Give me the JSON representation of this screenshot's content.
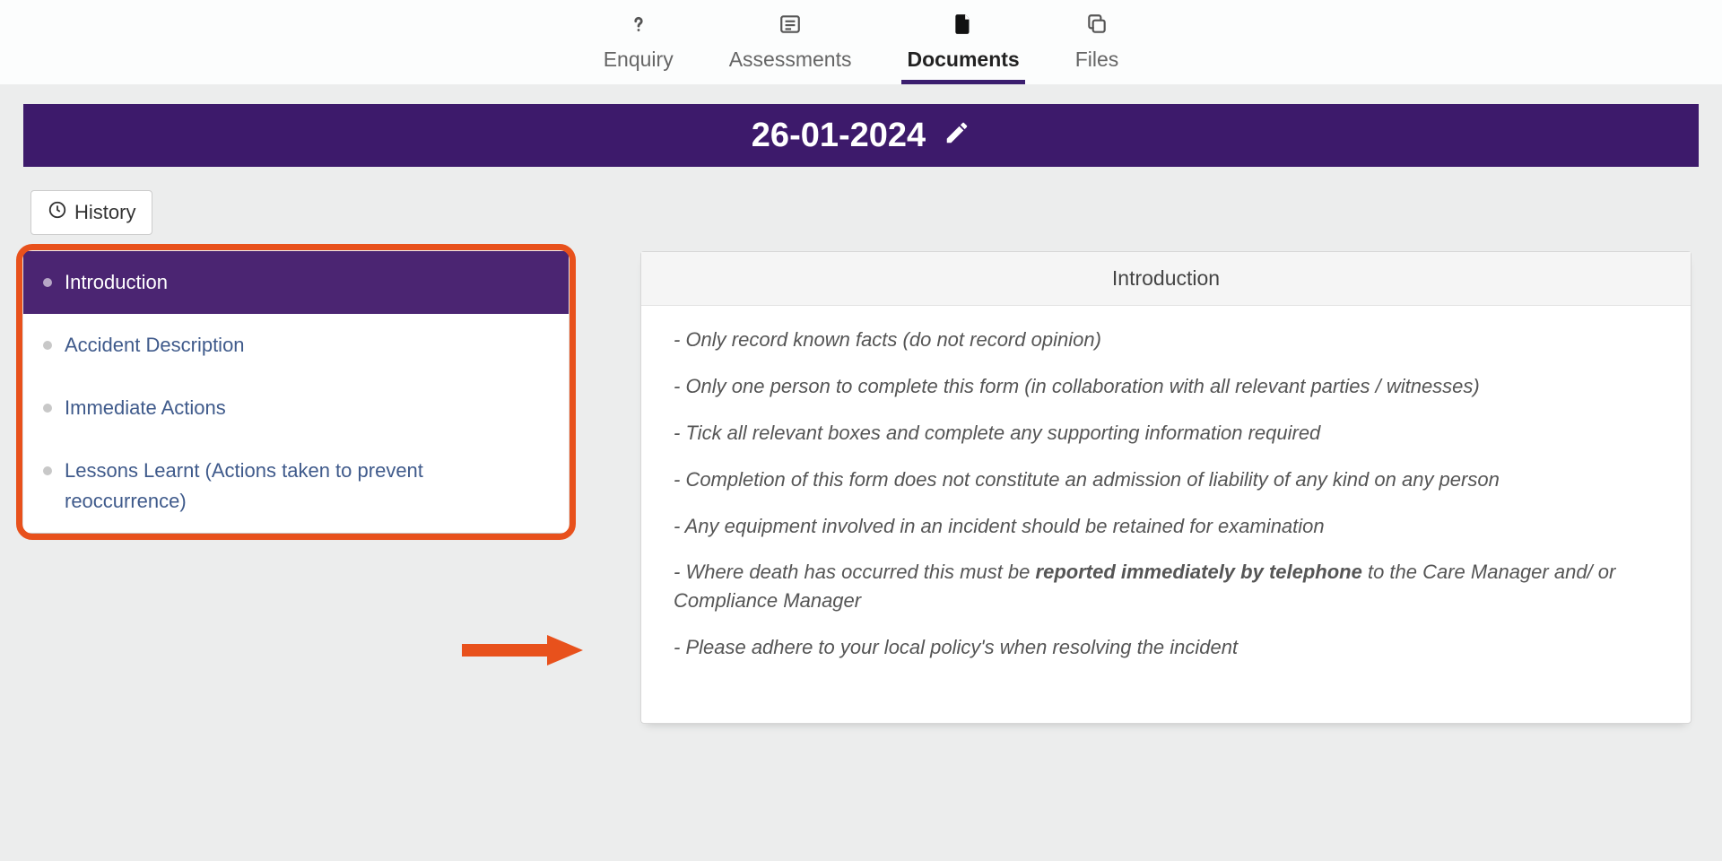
{
  "tabs": [
    {
      "label": "Enquiry",
      "icon": "question",
      "active": false
    },
    {
      "label": "Assessments",
      "icon": "list",
      "active": false
    },
    {
      "label": "Documents",
      "icon": "file",
      "active": true
    },
    {
      "label": "Files",
      "icon": "copy",
      "active": false
    }
  ],
  "datebar": {
    "date": "26-01-2024"
  },
  "history_label": "History",
  "sidebar": {
    "items": [
      {
        "label": "Introduction",
        "active": true
      },
      {
        "label": "Accident Description",
        "active": false
      },
      {
        "label": "Immediate Actions",
        "active": false
      },
      {
        "label": "Lessons Learnt (Actions taken to prevent reoccurrence)",
        "active": false
      }
    ]
  },
  "content": {
    "title": "Introduction",
    "line1": "- Only record known facts (do not record opinion)",
    "line2": "- Only one person to complete this form (in collaboration with all relevant parties / witnesses)",
    "line3": "- Tick all relevant boxes and complete any supporting information required",
    "line4": "- Completion of this form does not constitute an admission of liability of any kind on any person",
    "line5": "- Any equipment involved in an incident should be retained for examination",
    "line6_pre": "- Where death has occurred this must be ",
    "line6_bold": "reported immediately by telephone",
    "line6_post": " to the Care Manager  and/ or Compliance Manager",
    "line7": "- Please adhere to your local policy's when resolving the incident"
  }
}
